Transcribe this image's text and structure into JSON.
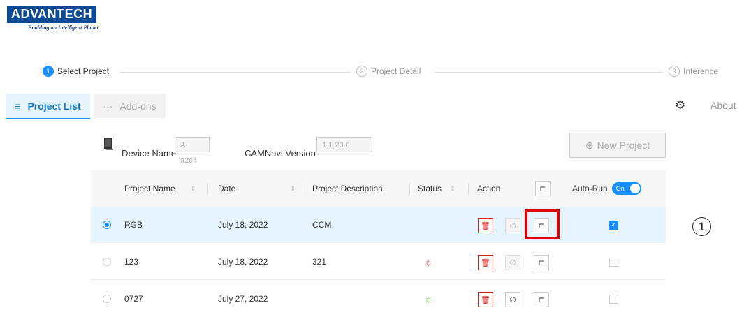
{
  "brand": {
    "name": "ADVANTECH",
    "tagline": "Enabling an Intelligent Planet"
  },
  "steps": [
    {
      "num": "1",
      "label": "Select Project"
    },
    {
      "num": "2",
      "label": "Project Detail"
    },
    {
      "num": "3",
      "label": "Inference"
    }
  ],
  "tabs": {
    "project_list": "Project List",
    "addons": "Add-ons",
    "list_icon": "≡",
    "addons_icon": "···"
  },
  "top_right": {
    "gear_icon": "⚙",
    "about": "About"
  },
  "device": {
    "name_label": "Device Name",
    "name_value": "A-a2c4",
    "version_label": "CAMNavi Version",
    "version_value": "1.1.20.0"
  },
  "new_project": {
    "icon": "⊕",
    "label": "New Project"
  },
  "table": {
    "headers": {
      "project_name": "Project Name",
      "date": "Date",
      "description": "Project Description",
      "status": "Status",
      "action": "Action",
      "auto_run": "Auto-Run",
      "toggle": "On",
      "sort_icon": "⇕",
      "export_icon": "⊏"
    },
    "rows": [
      {
        "name": "RGB",
        "date": "July 18, 2022",
        "description": "CCM",
        "selected": true,
        "status_color": "#e02020",
        "link_enabled": false,
        "auto_run": true
      },
      {
        "name": "123",
        "date": "July 18, 2022",
        "description": "321",
        "selected": false,
        "status_color": "#e02020",
        "link_enabled": false,
        "auto_run": false
      },
      {
        "name": "0727",
        "date": "July 27, 2022",
        "description": "",
        "selected": false,
        "status_color": "#52c41a",
        "link_enabled": true,
        "auto_run": false
      }
    ],
    "row_icons": {
      "status": "☼",
      "delete": "🗑",
      "link": "∅",
      "export": "⊏",
      "check": "✓"
    }
  },
  "callout": "1"
}
